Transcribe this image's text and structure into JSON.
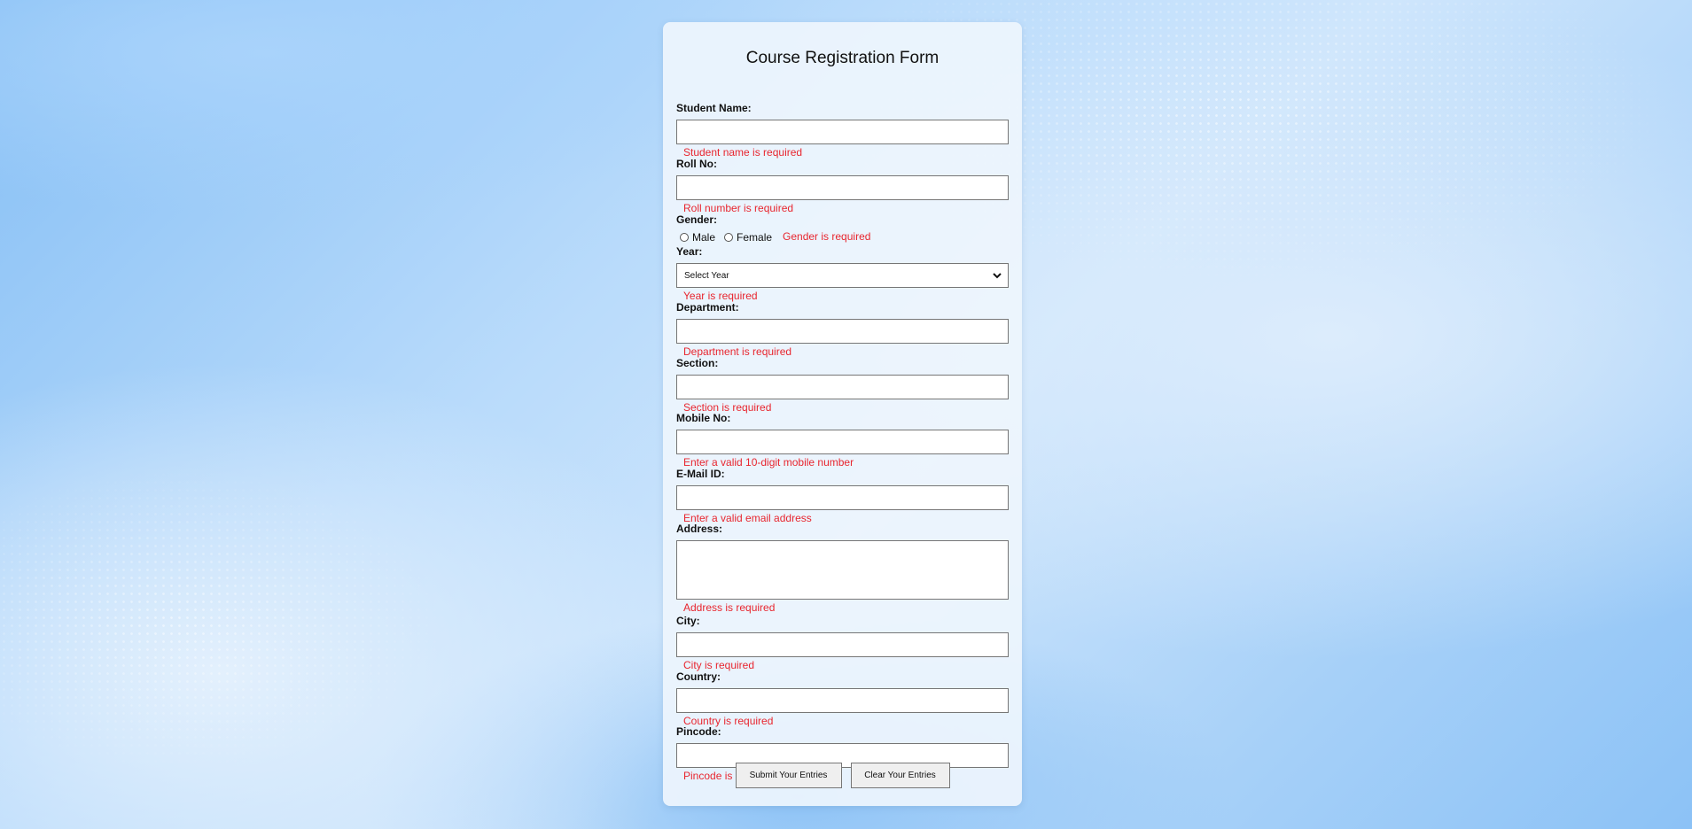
{
  "form": {
    "title": "Course Registration Form",
    "student_name": {
      "label": "Student Name:",
      "error": "Student name is required"
    },
    "roll_no": {
      "label": "Roll No:",
      "error": "Roll number is required"
    },
    "gender": {
      "label": "Gender:",
      "options": [
        "Male",
        "Female"
      ],
      "error": "Gender is required"
    },
    "year": {
      "label": "Year:",
      "selected": "Select Year",
      "error": "Year is required"
    },
    "department": {
      "label": "Department:",
      "error": "Department is required"
    },
    "section": {
      "label": "Section:",
      "error": "Section is required"
    },
    "mobile": {
      "label": "Mobile No:",
      "error": "Enter a valid 10-digit mobile number"
    },
    "email": {
      "label": "E-Mail ID:",
      "error": "Enter a valid email address"
    },
    "address": {
      "label": "Address:",
      "error": "Address is required"
    },
    "city": {
      "label": "City:",
      "error": "City is required"
    },
    "country": {
      "label": "Country:",
      "error": "Country is required"
    },
    "pincode": {
      "label": "Pincode:",
      "error": "Pincode is required"
    },
    "submit_label": "Submit Your Entries",
    "clear_label": "Clear Your Entries"
  },
  "colors": {
    "error": "#e8262f",
    "card": "#eef5fd"
  }
}
